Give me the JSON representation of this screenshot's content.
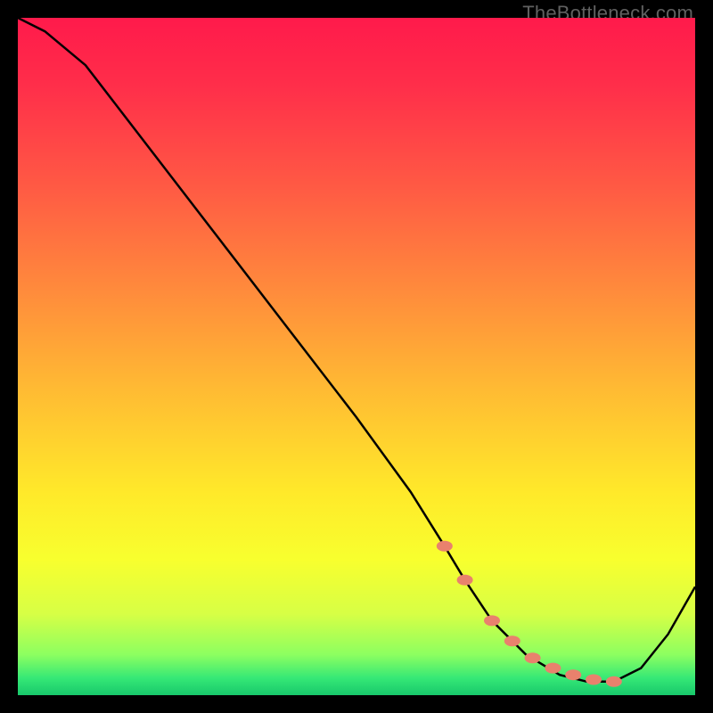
{
  "watermark": "TheBottleneck.com",
  "chart_data": {
    "type": "line",
    "title": "",
    "xlabel": "",
    "ylabel": "",
    "xlim": [
      0,
      100
    ],
    "ylim": [
      0,
      100
    ],
    "grid": false,
    "series": [
      {
        "name": "curve",
        "x": [
          0,
          4,
          10,
          20,
          30,
          40,
          50,
          58,
          63,
          66,
          70,
          75,
          80,
          84,
          88,
          92,
          96,
          100
        ],
        "y": [
          100,
          98,
          93,
          80,
          67,
          54,
          41,
          30,
          22,
          17,
          11,
          6,
          3,
          2,
          2,
          4,
          9,
          16
        ]
      }
    ],
    "markers": {
      "name": "highlight-dots",
      "x": [
        63,
        66,
        70,
        73,
        76,
        79,
        82,
        85,
        88
      ],
      "y": [
        22,
        17,
        11,
        8,
        5.5,
        4,
        3,
        2.3,
        2
      ]
    },
    "gradient_stops": [
      {
        "offset": 0.0,
        "color": "#ff1a4b"
      },
      {
        "offset": 0.1,
        "color": "#ff2e4a"
      },
      {
        "offset": 0.25,
        "color": "#ff5a44"
      },
      {
        "offset": 0.4,
        "color": "#ff8a3c"
      },
      {
        "offset": 0.55,
        "color": "#ffbb33"
      },
      {
        "offset": 0.7,
        "color": "#ffe92a"
      },
      {
        "offset": 0.8,
        "color": "#f8ff2e"
      },
      {
        "offset": 0.88,
        "color": "#d7ff45"
      },
      {
        "offset": 0.94,
        "color": "#8dff60"
      },
      {
        "offset": 0.975,
        "color": "#35e876"
      },
      {
        "offset": 1.0,
        "color": "#18c86b"
      }
    ],
    "marker_color": "#e9816d",
    "curve_color": "#000000"
  }
}
